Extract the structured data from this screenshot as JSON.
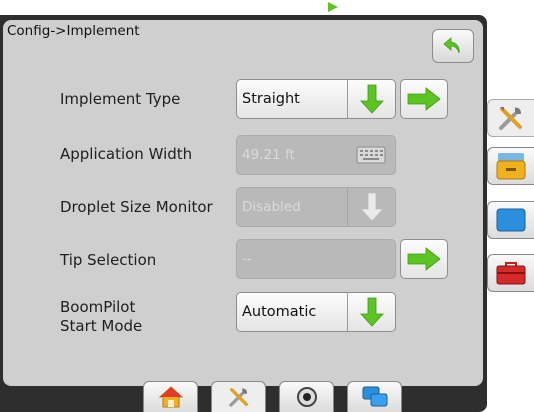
{
  "title": "Config->Implement",
  "icons": {
    "back": "back-arrow-icon",
    "down": "green-down-arrow-icon",
    "next": "green-right-arrow-icon",
    "keyboard": "keyboard-icon",
    "disabled_down": "gray-down-arrow-icon"
  },
  "colors": {
    "panel_bg": "#cfcfcf",
    "frame_bg": "#2e2e2e",
    "arrow_green": "#5cc424",
    "disabled_field": "#b9b9b9"
  },
  "rows": [
    {
      "label": "Implement Type",
      "value": "Straight",
      "state": "enabled",
      "action": "dropdown",
      "has_next": true
    },
    {
      "label": "Application Width",
      "value": "49.21 ft",
      "state": "disabled",
      "action": "keyboard",
      "has_next": false
    },
    {
      "label": "Droplet Size Monitor",
      "value": "Disabled",
      "state": "disabled",
      "action": "dropdown",
      "has_next": false
    },
    {
      "label": "Tip Selection",
      "value": "--",
      "state": "disabled",
      "action": "none",
      "has_next": true
    },
    {
      "label_line1": "BoomPilot",
      "label_line2": "Start Mode",
      "value": "Automatic",
      "state": "enabled",
      "action": "dropdown",
      "has_next": false
    }
  ],
  "side_tabs": [
    {
      "icon": "tools-icon",
      "active": true
    },
    {
      "icon": "console-icon",
      "active": false
    },
    {
      "icon": "display-icon",
      "active": false
    },
    {
      "icon": "toolbox-icon",
      "active": false
    }
  ],
  "bottom_tabs": [
    {
      "icon": "home-icon",
      "active": false
    },
    {
      "icon": "tools-icon",
      "active": true
    },
    {
      "icon": "gps-icon",
      "active": false
    },
    {
      "icon": "screens-icon",
      "active": false
    }
  ]
}
